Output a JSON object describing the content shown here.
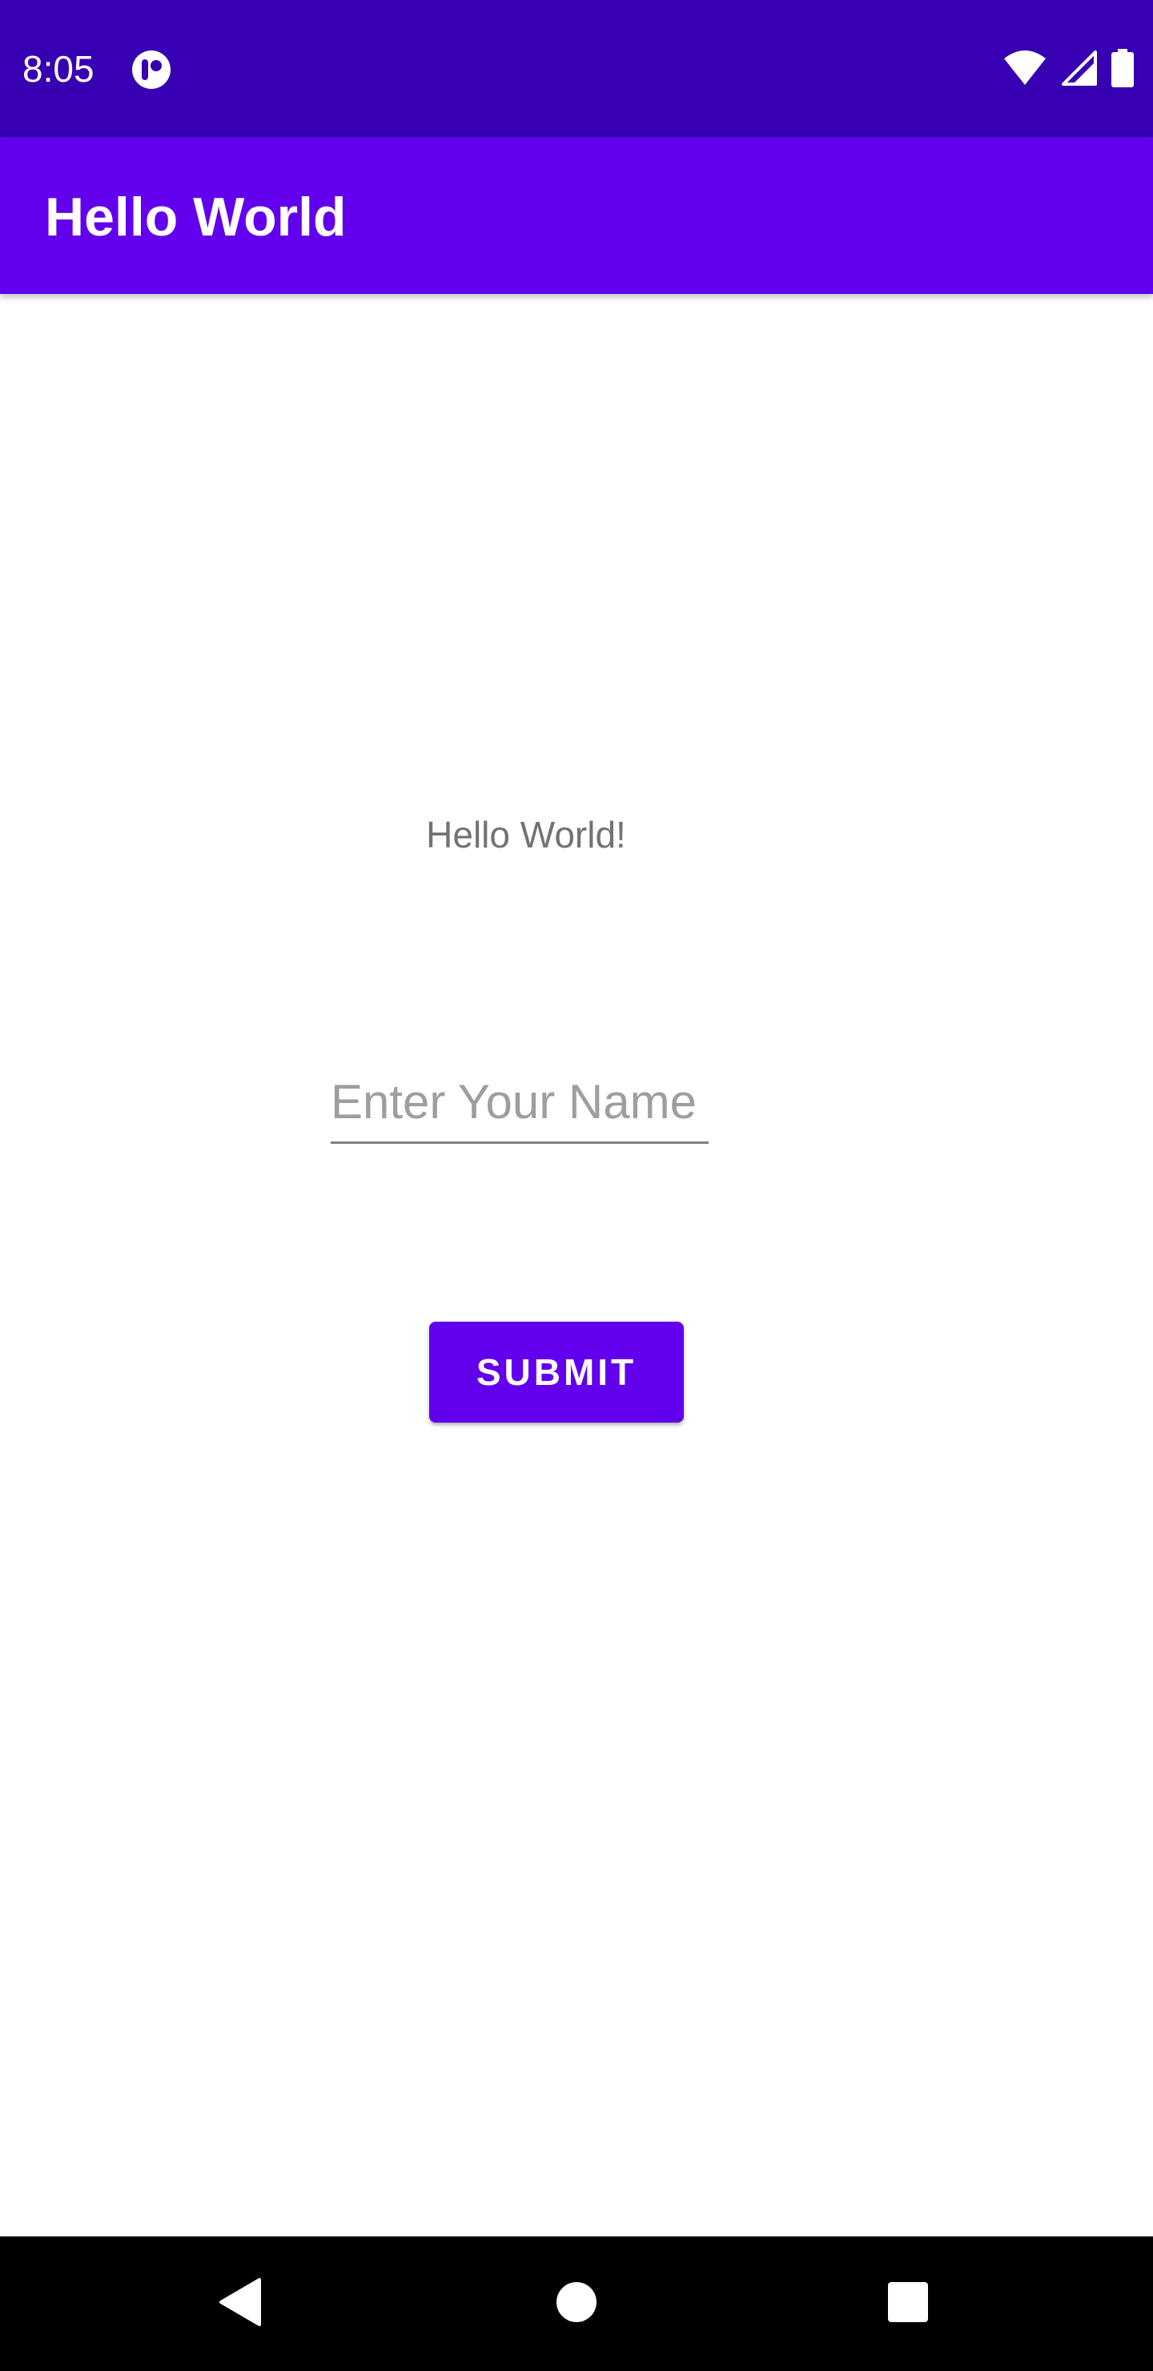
{
  "status_bar": {
    "time": "8:05",
    "notification_icon": "notification-app-icon",
    "wifi_icon": "wifi-icon",
    "signal_icon": "cell-signal-icon",
    "battery_icon": "battery-icon"
  },
  "app_bar": {
    "title": "Hello World"
  },
  "main": {
    "greeting": "Hello World!",
    "name_input": {
      "placeholder": "Enter Your Name",
      "value": ""
    },
    "submit_label": "SUBMIT"
  },
  "nav_bar": {
    "back_icon": "back-icon",
    "home_icon": "home-icon",
    "recents_icon": "recents-icon"
  },
  "colors": {
    "status_bar": "#3700b3",
    "primary": "#6200ee",
    "greeting_text": "#737373",
    "nav_bar": "#000000"
  }
}
